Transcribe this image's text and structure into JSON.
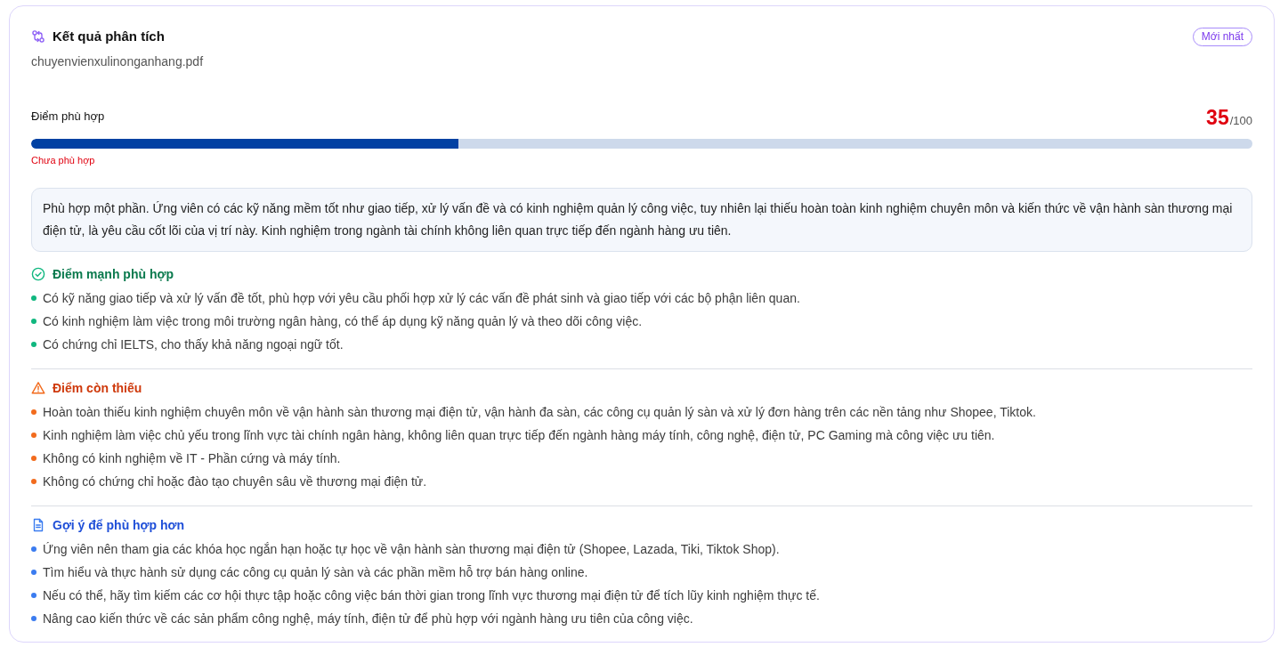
{
  "header": {
    "title": "Kết quả phân tích",
    "file_name": "chuyenvienxulinonganhang.pdf",
    "badge": "Mới nhất"
  },
  "score": {
    "label": "Điểm phù hợp",
    "value": "35",
    "max": "/100",
    "level": 0.35,
    "verdict": "Chưa phù hợp"
  },
  "summary": "Phù hợp một phần. Ứng viên có các kỹ năng mềm tốt như giao tiếp, xử lý vấn đề và có kinh nghiệm quản lý công việc, tuy nhiên lại thiếu hoàn toàn kinh nghiệm chuyên môn và kiến thức về vận hành sàn thương mại điện tử, là yêu cầu cốt lõi của vị trí này. Kinh nghiệm trong ngành tài chính không liên quan trực tiếp đến ngành hàng ưu tiên.",
  "sections": [
    {
      "kind": "strengths",
      "title": "Điểm mạnh phù hợp",
      "items": [
        "Có kỹ năng giao tiếp và xử lý vấn đề tốt, phù hợp với yêu cầu phối hợp xử lý các vấn đề phát sinh và giao tiếp với các bộ phận liên quan.",
        "Có kinh nghiệm làm việc trong môi trường ngân hàng, có thể áp dụng kỹ năng quản lý và theo dõi công việc.",
        "Có chứng chỉ IELTS, cho thấy khả năng ngoại ngữ tốt."
      ]
    },
    {
      "kind": "gaps",
      "title": "Điểm còn thiếu",
      "items": [
        "Hoàn toàn thiếu kinh nghiệm chuyên môn về vận hành sàn thương mại điện tử, vận hành đa sàn, các công cụ quản lý sàn và xử lý đơn hàng trên các nền tảng như Shopee, Tiktok.",
        "Kinh nghiệm làm việc chủ yếu trong lĩnh vực tài chính ngân hàng, không liên quan trực tiếp đến ngành hàng máy tính, công nghệ, điện tử, PC Gaming mà công việc ưu tiên.",
        "Không có kinh nghiệm về IT - Phần cứng và máy tính.",
        "Không có chứng chỉ hoặc đào tạo chuyên sâu về thương mại điện tử."
      ]
    },
    {
      "kind": "suggestions",
      "title": "Gợi ý để phù hợp hơn",
      "items": [
        "Ứng viên nên tham gia các khóa học ngắn hạn hoặc tự học về vận hành sàn thương mại điện tử (Shopee, Lazada, Tiki, Tiktok Shop).",
        "Tìm hiểu và thực hành sử dụng các công cụ quản lý sàn và các phần mềm hỗ trợ bán hàng online.",
        "Nếu có thể, hãy tìm kiếm các cơ hội thực tập hoặc công việc bán thời gian trong lĩnh vực thương mại điện tử để tích lũy kinh nghiệm thực tế.",
        "Nâng cao kiến thức về các sản phẩm công nghệ, máy tính, điện tử để phù hợp với ngành hàng ưu tiên của công việc."
      ]
    }
  ]
}
